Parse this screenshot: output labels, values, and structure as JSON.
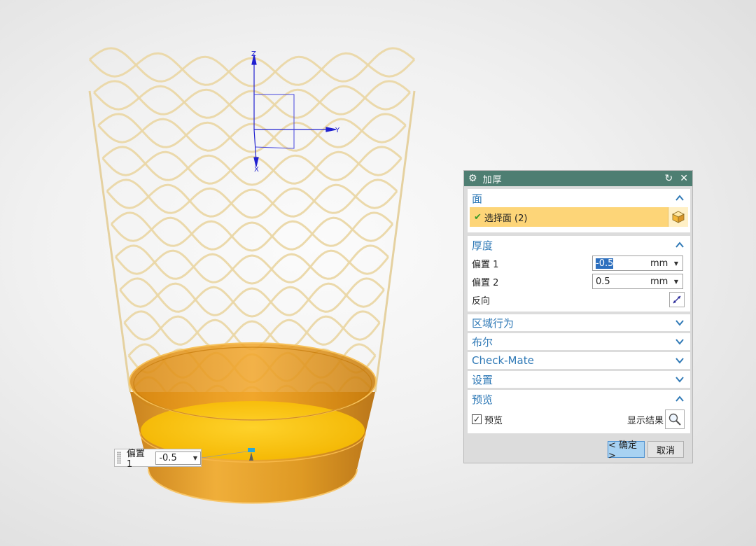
{
  "float_input": {
    "label": "偏置 1",
    "value": "-0.5"
  },
  "axes": {
    "z": "Z",
    "y": "Y",
    "x": "X"
  },
  "dialog": {
    "title": "加厚",
    "sections": {
      "face": {
        "title": "面",
        "select_label": "选择面 (2)"
      },
      "thickness": {
        "title": "厚度",
        "offset1_label": "偏置 1",
        "offset1_value": "-0.5",
        "offset1_unit": "mm",
        "offset2_label": "偏置 2",
        "offset2_value": "0.5",
        "offset2_unit": "mm",
        "reverse_label": "反向"
      },
      "region": {
        "title": "区域行为"
      },
      "boolean": {
        "title": "布尔"
      },
      "checkmate": {
        "title": "Check-Mate"
      },
      "settings": {
        "title": "设置"
      },
      "preview": {
        "title": "预览",
        "preview_label": "预览",
        "show_result_label": "显示结果"
      }
    },
    "ok_label": "< 确定 >",
    "cancel_label": "取消"
  },
  "colors": {
    "titlebar": "#4e7e72",
    "section_title": "#2f79b6",
    "highlight": "#fdd578",
    "part_orange": "#e8a020",
    "wire": "#ead7a6"
  }
}
